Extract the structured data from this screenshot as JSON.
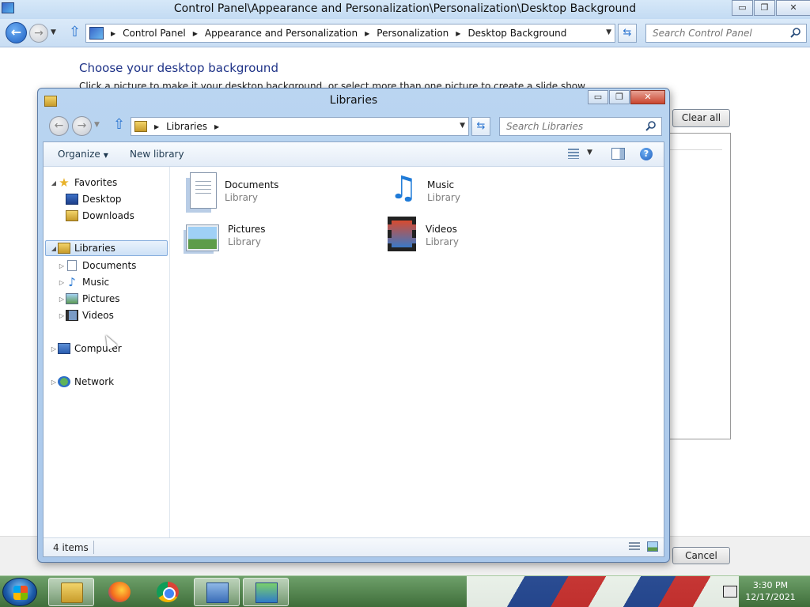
{
  "control_panel": {
    "title": "Control Panel\\Appearance and Personalization\\Personalization\\Desktop Background",
    "window_buttons": {
      "minimize": "▭",
      "maximize": "❐",
      "close": "✕"
    },
    "breadcrumbs": [
      "Control Panel",
      "Appearance and Personalization",
      "Personalization",
      "Desktop Background"
    ],
    "search_placeholder": "Search Control Panel",
    "heading": "Choose your desktop background",
    "subtext": "Click a picture to make it your desktop background, or select more than one picture to create a slide show.",
    "clear_all_label": "Clear all",
    "cancel_label": "Cancel"
  },
  "libraries_window": {
    "title": "Libraries",
    "window_buttons": {
      "minimize": "▭",
      "maximize": "❐",
      "close": "✕"
    },
    "breadcrumb": "Libraries",
    "search_placeholder": "Search Libraries",
    "toolbar": {
      "organize_label": "Organize",
      "new_library_label": "New library"
    },
    "nav_pane": {
      "favorites": {
        "label": "Favorites",
        "children": [
          "Desktop",
          "Downloads"
        ]
      },
      "libraries": {
        "label": "Libraries",
        "children": [
          "Documents",
          "Music",
          "Pictures",
          "Videos"
        ]
      },
      "computer": {
        "label": "Computer"
      },
      "network": {
        "label": "Network"
      }
    },
    "items": [
      {
        "name": "Documents",
        "type": "Library",
        "icon": "documents-library-icon"
      },
      {
        "name": "Music",
        "type": "Library",
        "icon": "music-library-icon"
      },
      {
        "name": "Pictures",
        "type": "Library",
        "icon": "pictures-library-icon"
      },
      {
        "name": "Videos",
        "type": "Library",
        "icon": "videos-library-icon"
      }
    ],
    "status": "4 items"
  },
  "taskbar": {
    "apps": [
      "windows-explorer-icon",
      "firefox-icon",
      "chrome-icon",
      "control-panel-icon",
      "personalization-icon"
    ],
    "clock": {
      "time": "3:30 PM",
      "date": "12/17/2021"
    }
  },
  "colors": {
    "heading": "#1e3287",
    "titlebar": "#c3dbf3",
    "selection": "#cde1f6",
    "taskbar": "#4f7e4a"
  }
}
